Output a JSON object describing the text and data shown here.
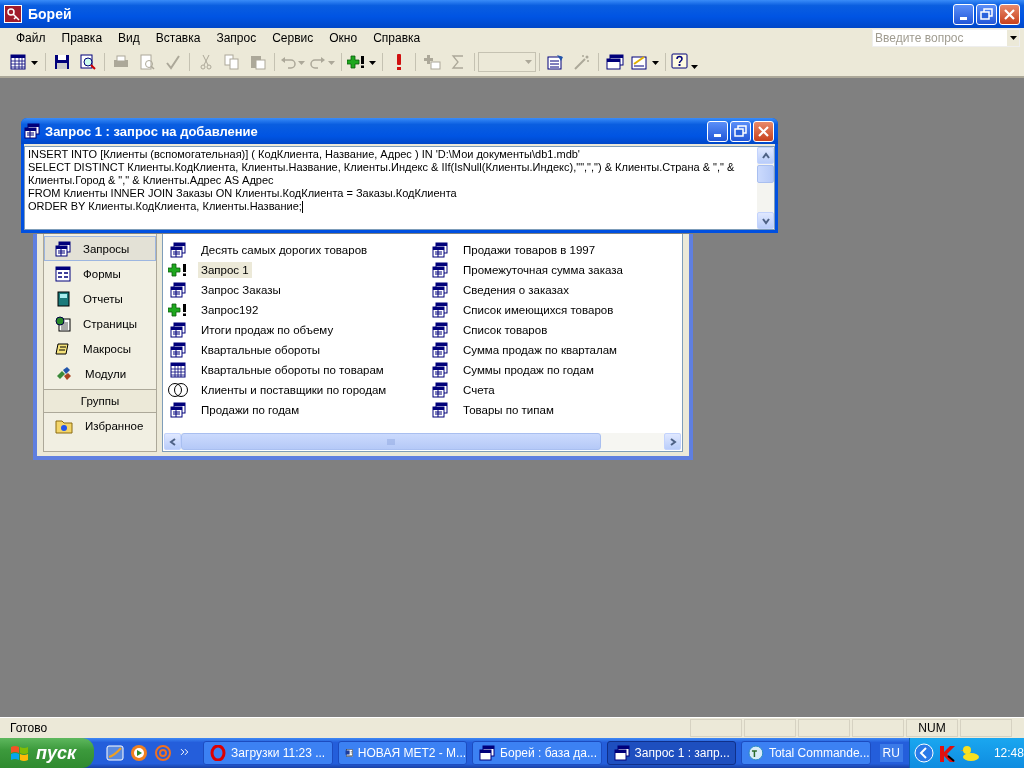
{
  "window": {
    "title": "Борей"
  },
  "menu": [
    "Файл",
    "Правка",
    "Вид",
    "Вставка",
    "Запрос",
    "Сервис",
    "Окно",
    "Справка"
  ],
  "help_box": {
    "placeholder": "Введите вопрос"
  },
  "toolbar": [
    {
      "kind": "view",
      "disabled": false
    },
    {
      "kind": "sep"
    },
    {
      "kind": "save",
      "disabled": false
    },
    {
      "kind": "search",
      "disabled": false
    },
    {
      "kind": "sep"
    },
    {
      "kind": "print",
      "disabled": true
    },
    {
      "kind": "preview",
      "disabled": true
    },
    {
      "kind": "spell",
      "disabled": true
    },
    {
      "kind": "sep"
    },
    {
      "kind": "cut",
      "disabled": true
    },
    {
      "kind": "copy",
      "disabled": true
    },
    {
      "kind": "paste",
      "disabled": true
    },
    {
      "kind": "sep"
    },
    {
      "kind": "undo",
      "disabled": true
    },
    {
      "kind": "redo",
      "disabled": true
    },
    {
      "kind": "sep"
    },
    {
      "kind": "append",
      "disabled": false
    },
    {
      "kind": "sep"
    },
    {
      "kind": "run",
      "disabled": false
    },
    {
      "kind": "sep"
    },
    {
      "kind": "addtable",
      "disabled": true
    },
    {
      "kind": "sum",
      "disabled": true
    },
    {
      "kind": "sep"
    },
    {
      "kind": "combo",
      "disabled": true
    },
    {
      "kind": "sep"
    },
    {
      "kind": "properties",
      "disabled": false
    },
    {
      "kind": "build",
      "disabled": true
    },
    {
      "kind": "sep"
    },
    {
      "kind": "dbwindow",
      "disabled": false
    },
    {
      "kind": "newobject",
      "disabled": false
    },
    {
      "kind": "sep"
    },
    {
      "kind": "help",
      "disabled": false
    }
  ],
  "query_window": {
    "title": "Запрос 1 : запрос на добавление",
    "sql": [
      "INSERT INTO [Клиенты (вспомогательная)] ( КодКлиента, Название, Адрес ) IN 'D:\\Мои документы\\db1.mdb'",
      "SELECT DISTINCT Клиенты.КодКлиента, Клиенты.Название, Клиенты.Индекс & IIf(IsNull(Клиенты.Индекс),\"\",\",\") & Клиенты.Страна & \",\" & Клиенты.Город & \",\" & Клиенты.Адрес AS Адрес",
      "FROM Клиенты INNER JOIN Заказы ON Клиенты.КодКлиента = Заказы.КодКлиента",
      "ORDER BY Клиенты.КодКлиента, Клиенты.Название;"
    ]
  },
  "database_window": {
    "objects": [
      {
        "label": "Запросы",
        "kind": "queries",
        "selected": true
      },
      {
        "label": "Формы",
        "kind": "forms",
        "selected": false
      },
      {
        "label": "Отчеты",
        "kind": "reports",
        "selected": false
      },
      {
        "label": "Страницы",
        "kind": "pages",
        "selected": false
      },
      {
        "label": "Макросы",
        "kind": "macros",
        "selected": false
      },
      {
        "label": "Модули",
        "kind": "modules",
        "selected": false
      }
    ],
    "groups_header": "Группы",
    "groups": [
      {
        "label": "Избранное",
        "selected": false
      }
    ],
    "items": [
      {
        "label": "Десять самых дорогих товаров",
        "kind": "select",
        "selected": false
      },
      {
        "label": "Запрос 1",
        "kind": "append",
        "selected": true
      },
      {
        "label": "Запрос Заказы",
        "kind": "select",
        "selected": false
      },
      {
        "label": "Запрос192",
        "kind": "append",
        "selected": false
      },
      {
        "label": "Итоги продаж по объему",
        "kind": "select",
        "selected": false
      },
      {
        "label": "Квартальные обороты",
        "kind": "select",
        "selected": false
      },
      {
        "label": "Квартальные обороты по товарам",
        "kind": "crosstab",
        "selected": false
      },
      {
        "label": "Клиенты и поставщики по городам",
        "kind": "union",
        "selected": false
      },
      {
        "label": "Продажи по годам",
        "kind": "select",
        "selected": false
      },
      {
        "label": "Продажи товаров в 1997",
        "kind": "select",
        "selected": false
      },
      {
        "label": "Промежуточная сумма заказа",
        "kind": "select",
        "selected": false
      },
      {
        "label": "Сведения о заказах",
        "kind": "select",
        "selected": false
      },
      {
        "label": "Список имеющихся товаров",
        "kind": "select",
        "selected": false
      },
      {
        "label": "Список товаров",
        "kind": "select",
        "selected": false
      },
      {
        "label": "Сумма продаж по кварталам",
        "kind": "select",
        "selected": false
      },
      {
        "label": "Суммы продаж по годам",
        "kind": "select",
        "selected": false
      },
      {
        "label": "Счета",
        "kind": "select",
        "selected": false
      },
      {
        "label": "Товары по типам",
        "kind": "select",
        "selected": false
      }
    ]
  },
  "status_bar": {
    "text": "Готово",
    "indicator": "NUM"
  },
  "taskbar": {
    "start": "пуск",
    "quick_launch": [
      {
        "kind": "mail"
      },
      {
        "kind": "player"
      },
      {
        "kind": "at"
      }
    ],
    "tasks": [
      {
        "label": "Загрузки 11:23 ...",
        "kind": "opera",
        "selected": false
      },
      {
        "label": "НОВАЯ МЕТ2 - М...",
        "kind": "word",
        "selected": false
      },
      {
        "label": "Борей : база да...",
        "kind": "access",
        "selected": false
      },
      {
        "label": "Запрос 1 : запр...",
        "kind": "access",
        "selected": true
      },
      {
        "label": "Total Commande...",
        "kind": "tc",
        "selected": false
      }
    ],
    "language": "RU",
    "clock": "12:48"
  }
}
